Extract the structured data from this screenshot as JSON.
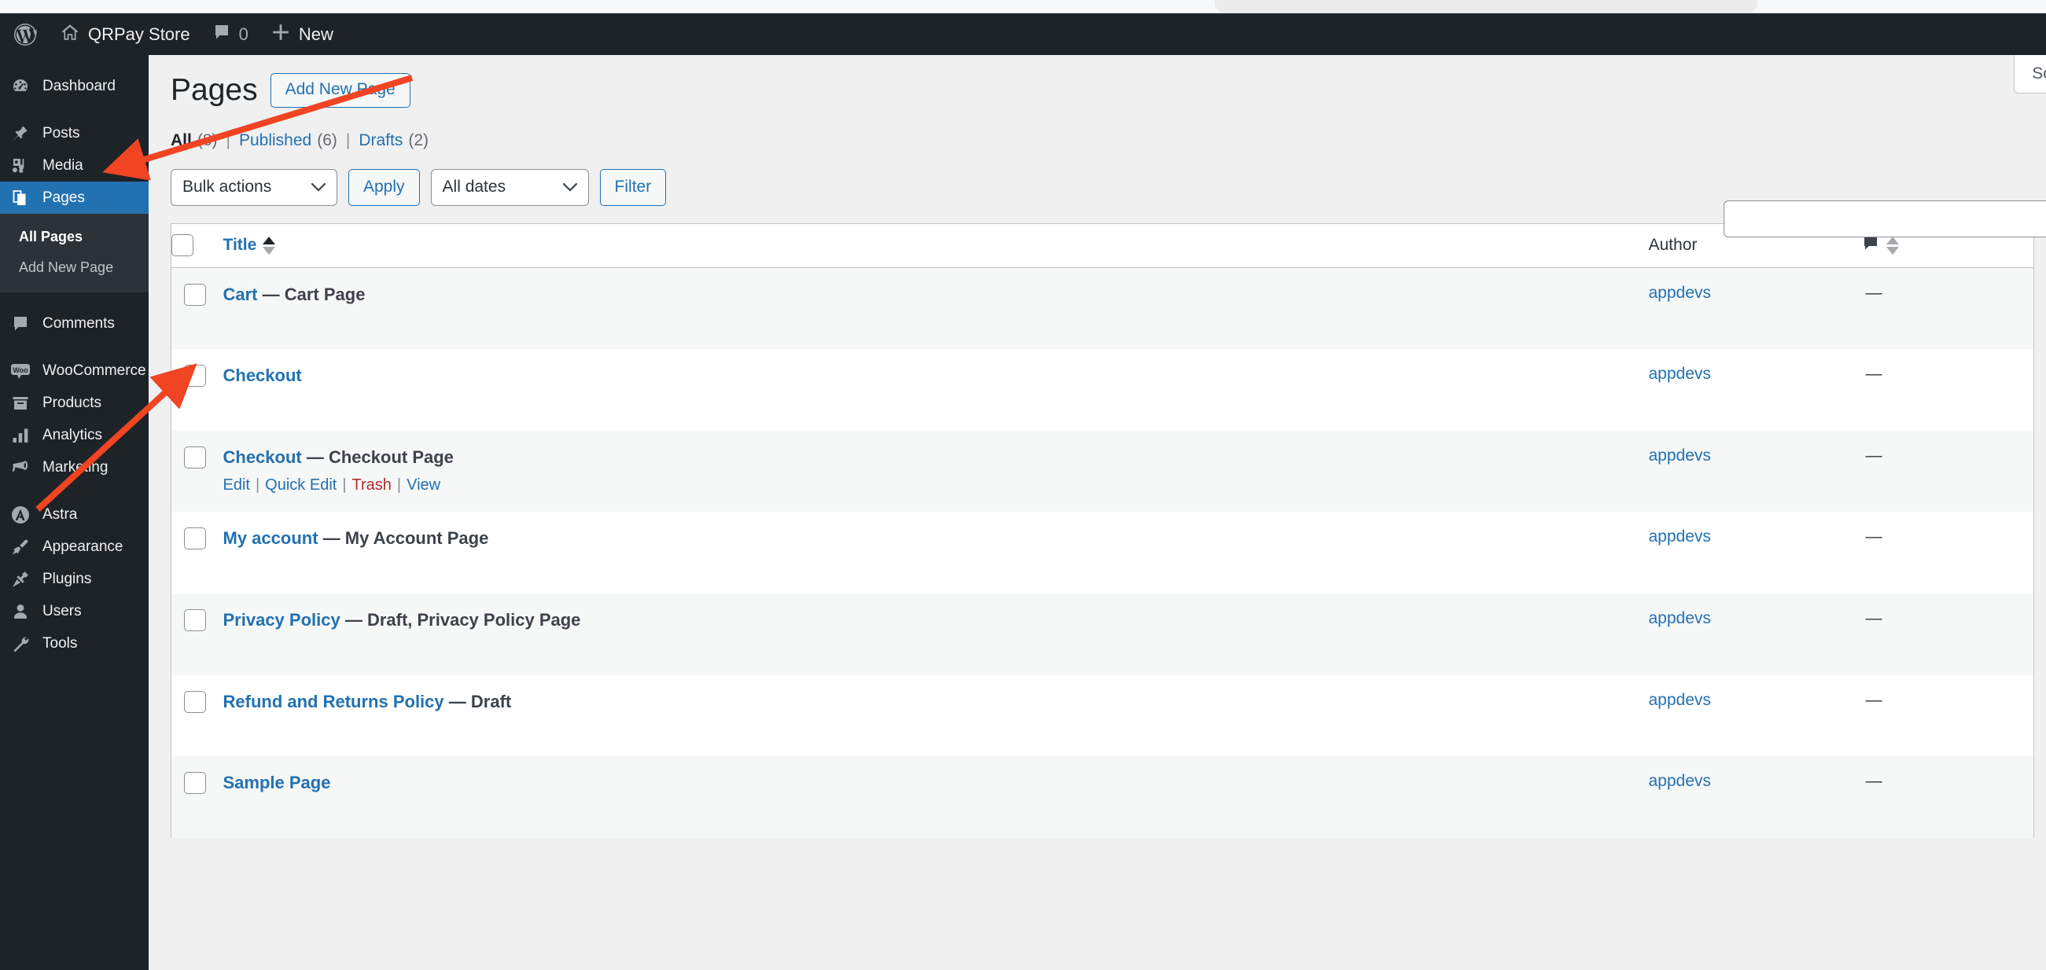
{
  "adminbar": {
    "site_name": "QRPay Store",
    "comment_count": "0",
    "new_label": "New",
    "wp_logo_icon": "wordpress-logo-icon",
    "home_icon": "home-icon",
    "comment_icon": "comment-bubble-icon",
    "plus_icon": "plus-icon"
  },
  "sidebar": {
    "items": [
      {
        "label": "Dashboard",
        "icon": "dashboard-icon",
        "current": false
      },
      {
        "label": "Posts",
        "icon": "pin-icon",
        "current": false
      },
      {
        "label": "Media",
        "icon": "media-icon",
        "current": false
      },
      {
        "label": "Pages",
        "icon": "pages-icon",
        "current": true
      },
      {
        "label": "Comments",
        "icon": "comment-bubble-icon",
        "current": false
      },
      {
        "label": "WooCommerce",
        "icon": "woo-icon",
        "current": false
      },
      {
        "label": "Products",
        "icon": "products-box-icon",
        "current": false
      },
      {
        "label": "Analytics",
        "icon": "bar-chart-icon",
        "current": false
      },
      {
        "label": "Marketing",
        "icon": "megaphone-icon",
        "current": false
      },
      {
        "label": "Astra",
        "icon": "astra-icon",
        "current": false
      },
      {
        "label": "Appearance",
        "icon": "paintbrush-icon",
        "current": false
      },
      {
        "label": "Plugins",
        "icon": "plug-icon",
        "current": false
      },
      {
        "label": "Users",
        "icon": "user-icon",
        "current": false
      },
      {
        "label": "Tools",
        "icon": "tools-icon",
        "current": false
      }
    ],
    "submenu": [
      {
        "label": "All Pages",
        "current": true
      },
      {
        "label": "Add New Page",
        "current": false
      }
    ]
  },
  "screen_meta": {
    "screen_options_label": "Screen Options"
  },
  "header": {
    "title": "Pages",
    "add_new_label": "Add New Page"
  },
  "views": {
    "items": [
      {
        "label": "All",
        "count": "(8)",
        "current": true
      },
      {
        "label": "Published",
        "count": "(6)",
        "current": false
      },
      {
        "label": "Drafts",
        "count": "(2)",
        "current": false
      }
    ],
    "separator": "|"
  },
  "search": {
    "value": "",
    "placeholder": ""
  },
  "tablenav": {
    "bulk_actions_value": "Bulk actions",
    "apply_label": "Apply",
    "all_dates_value": "All dates",
    "filter_label": "Filter",
    "chevron_icon": "chevron-down-icon"
  },
  "table": {
    "columns": {
      "title": "Title",
      "author": "Author",
      "comments_icon": "comment-bubble-icon",
      "sort_icon": "sort-arrows-icon"
    },
    "rows": [
      {
        "title": "Cart",
        "state": " — Cart Page",
        "author": "appdevs",
        "comments": "—",
        "actions_visible": false
      },
      {
        "title": "Checkout",
        "state": "",
        "author": "appdevs",
        "comments": "—",
        "actions_visible": false
      },
      {
        "title": "Checkout",
        "state": " — Checkout Page",
        "author": "appdevs",
        "comments": "—",
        "actions_visible": true
      },
      {
        "title": "My account",
        "state": " — My Account Page",
        "author": "appdevs",
        "comments": "—",
        "actions_visible": false
      },
      {
        "title": "Privacy Policy",
        "state": " — Draft, Privacy Policy Page",
        "author": "appdevs",
        "comments": "—",
        "actions_visible": false
      },
      {
        "title": "Refund and Returns Policy",
        "state": " — Draft",
        "author": "appdevs",
        "comments": "—",
        "actions_visible": false
      },
      {
        "title": "Sample Page",
        "state": "",
        "author": "appdevs",
        "comments": "—",
        "actions_visible": false
      }
    ],
    "row_actions": {
      "edit": "Edit",
      "quick_edit": "Quick Edit",
      "trash": "Trash",
      "view": "View",
      "separator": "|"
    }
  },
  "annotations": {
    "arrow_color": "#f04423",
    "arrows": [
      {
        "name": "arrow-to-pages-menu"
      },
      {
        "name": "arrow-to-row-actions"
      }
    ]
  }
}
